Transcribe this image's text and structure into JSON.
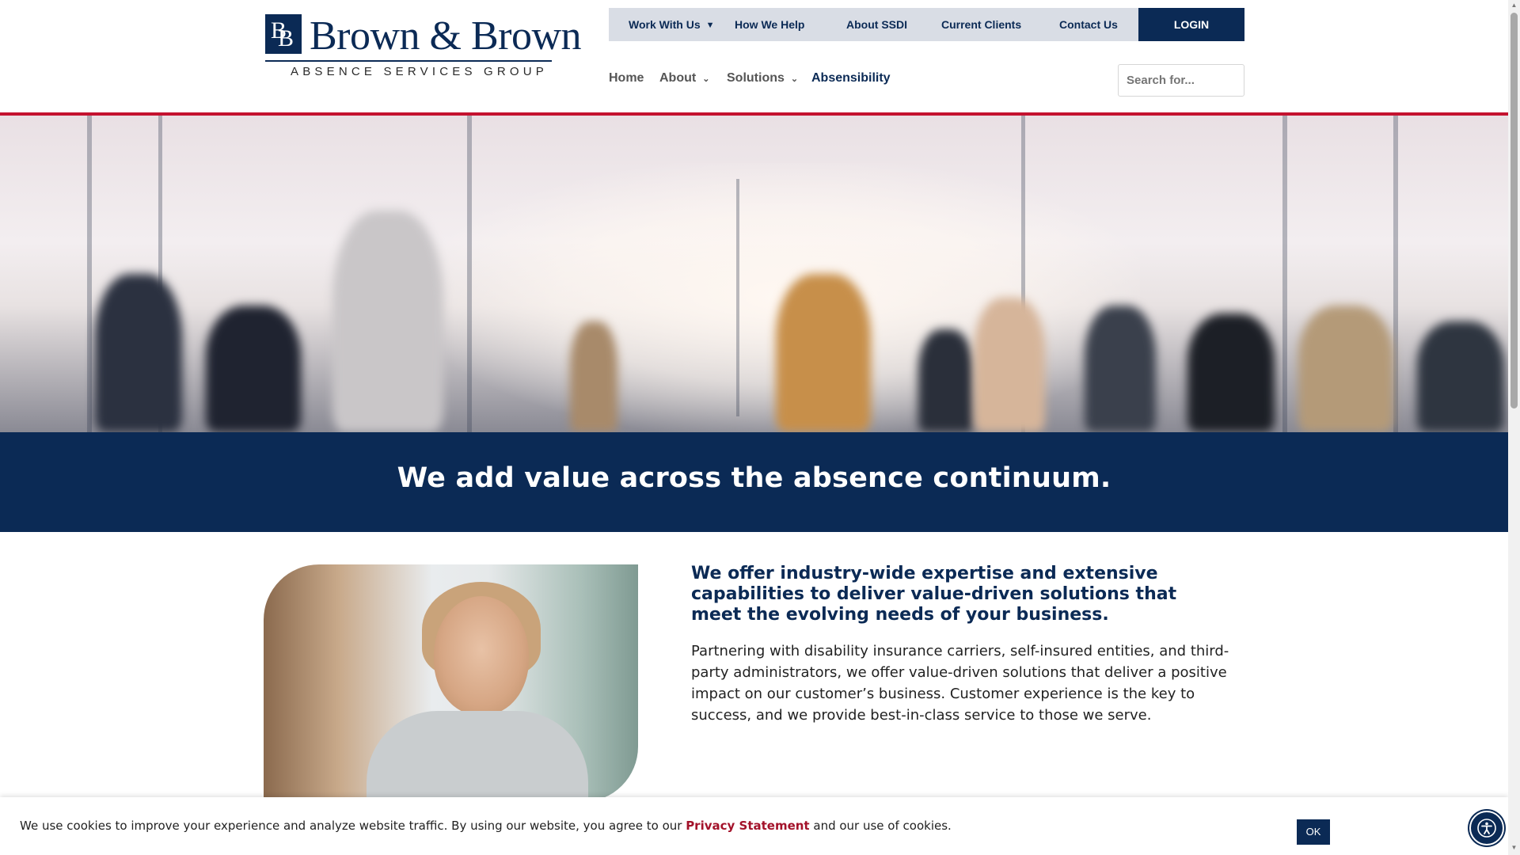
{
  "logo": {
    "mark_letter_1": "B",
    "mark_letter_2": "B",
    "name": "Brown & Brown",
    "tagline": "ABSENCE SERVICES GROUP"
  },
  "topbar": {
    "items": [
      {
        "label": "Work With Us"
      },
      {
        "label": "How We Help"
      },
      {
        "label": "About SSDI"
      },
      {
        "label": "Current Clients"
      },
      {
        "label": "Contact Us"
      }
    ],
    "login_label": "LOGIN"
  },
  "mainnav": {
    "items": [
      {
        "label": "Home"
      },
      {
        "label": "About"
      },
      {
        "label": "Solutions"
      },
      {
        "label": "Absensibility"
      }
    ]
  },
  "search": {
    "placeholder": "Search for..."
  },
  "banner": {
    "headline": "We add value across the absence continuum."
  },
  "intro": {
    "title": "We offer industry-wide expertise and extensive capabilities to deliver value-driven solutions that meet the evolving needs of your business.",
    "body": "Partnering with disability insurance carriers, self-insured entities, and third-party administrators, we offer value-driven solutions that deliver a positive impact on our customer’s business. Customer experience is the key to success, and we provide best-in-class service to those we serve."
  },
  "cookie": {
    "text_before": "We use cookies to improve your experience and analyze website traffic. By using our website, you agree to our ",
    "link": "Privacy Statement",
    "text_after": " and our use of cookies.",
    "ok_label": "OK"
  },
  "colors": {
    "brand_navy": "#0b2a55",
    "accent_red": "#c4122f",
    "topbar_bg": "#d9dde5"
  },
  "icons": {
    "dropdown": "chevron-down-icon",
    "accessibility": "accessibility-icon"
  }
}
